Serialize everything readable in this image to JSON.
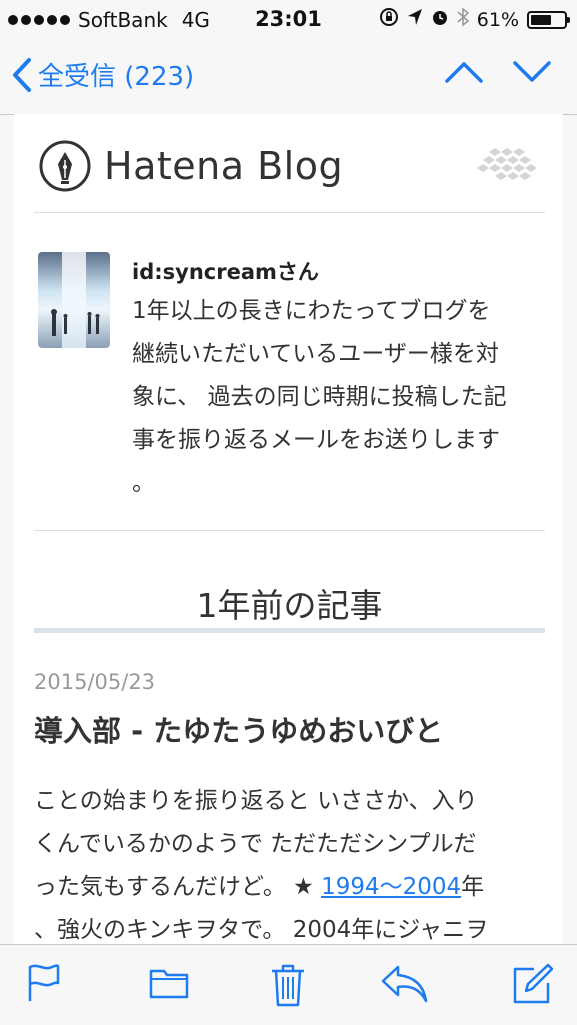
{
  "status_bar": {
    "carrier": "SoftBank",
    "network": "4G",
    "time": "23:01",
    "battery_percent": "61%",
    "battery_level": 0.61
  },
  "nav": {
    "back_label": "全受信 (223)",
    "icons": [
      "chevron-left-icon",
      "chevron-up-icon",
      "chevron-down-icon"
    ]
  },
  "mail": {
    "logo_text": "Hatena Blog",
    "intro": {
      "user": "id:syncreamさん",
      "line1": "1年以上の長きにわたってブログを",
      "line2": "継続いただいているユーザー様を対",
      "line3": "象に、 過去の同じ時期に投稿した記",
      "line4": "事を振り返るメールをお送りします",
      "line5": "。"
    },
    "section_title": "1年前の記事",
    "article": {
      "date": "2015/05/23",
      "title": "導入部 - たゆたうゆめおいびと",
      "line1": "ことの始まりを振り返ると いささか、入り",
      "line2": "くんでいるかのようで ただただシンプルだ",
      "line3_pre": "った気もするんだけど。 ★ ",
      "line3_link": "1994〜2004",
      "line3_post": "年",
      "line4": "、強火のキンキヲタで。 2004年にジャニヲ"
    }
  },
  "toolbar": {
    "icons": [
      "flag-icon",
      "folder-icon",
      "trash-icon",
      "reply-icon",
      "compose-icon"
    ]
  },
  "colors": {
    "accent": "#1e7cf0",
    "link": "#1e7cf0",
    "background": "#f7f7f7"
  }
}
